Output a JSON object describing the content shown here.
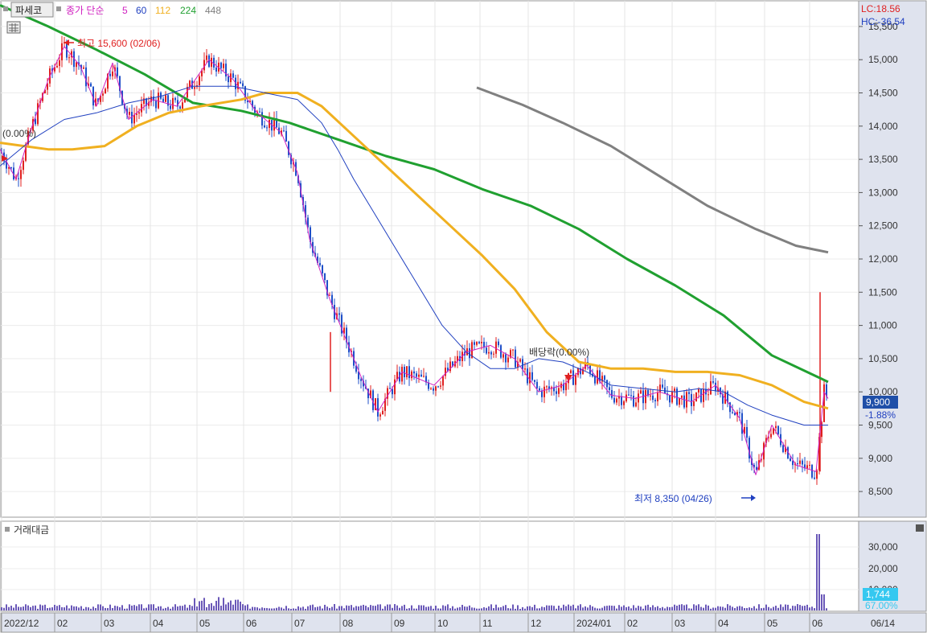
{
  "header": {
    "stock_name": "파세코",
    "indicator": "종가 단순",
    "ma_labels": [
      {
        "text": "5",
        "color": "#d020c0"
      },
      {
        "text": "60",
        "color": "#2040c0"
      },
      {
        "text": "112",
        "color": "#f0b020"
      },
      {
        "text": "224",
        "color": "#20a030"
      },
      {
        "text": "448",
        "color": "#808080"
      }
    ],
    "lc": "LC:18.56",
    "hc": "HC:-36.54"
  },
  "annotations": {
    "high": "최고 15,600 (02/06)",
    "low": "최저 8,350 (04/26)",
    "dividend": "배당락(0.00%)",
    "left_pct": "(0.00%)"
  },
  "current": {
    "price": "9,900",
    "change": "-1.88%",
    "volume": "1,744",
    "volume_pct": "67.00%"
  },
  "volume_panel": {
    "title": "거래대금"
  },
  "chart_data": {
    "type": "line",
    "price_axis": {
      "min": 8150,
      "max": 15850,
      "ticks": [
        "15,500",
        "15,000",
        "14,500",
        "14,000",
        "13,500",
        "13,000",
        "12,500",
        "12,000",
        "11,500",
        "11,000",
        "10,500",
        "10,000",
        "9,500",
        "9,000",
        "8,500"
      ]
    },
    "volume_axis": {
      "ticks": [
        "30,000",
        "20,000",
        "10,000"
      ]
    },
    "x_labels": [
      "2022/12",
      "02",
      "03",
      "04",
      "05",
      "06",
      "07",
      "08",
      "09",
      "10",
      "11",
      "12",
      "2024/01",
      "02",
      "03",
      "04",
      "05",
      "06",
      "06/14"
    ],
    "series": [
      {
        "name": "224",
        "color": "#20a030",
        "points": [
          [
            0,
            15820
          ],
          [
            60,
            15500
          ],
          [
            120,
            15150
          ],
          [
            180,
            14780
          ],
          [
            240,
            14350
          ],
          [
            300,
            14230
          ],
          [
            360,
            14050
          ],
          [
            420,
            13800
          ],
          [
            480,
            13550
          ],
          [
            540,
            13350
          ],
          [
            600,
            13050
          ],
          [
            660,
            12800
          ],
          [
            720,
            12450
          ],
          [
            780,
            12000
          ],
          [
            840,
            11600
          ],
          [
            900,
            11150
          ],
          [
            960,
            10550
          ],
          [
            1030,
            10150
          ]
        ]
      },
      {
        "name": "448",
        "color": "#808080",
        "points": [
          [
            593,
            14580
          ],
          [
            650,
            14320
          ],
          [
            700,
            14050
          ],
          [
            760,
            13700
          ],
          [
            820,
            13250
          ],
          [
            880,
            12800
          ],
          [
            940,
            12450
          ],
          [
            990,
            12200
          ],
          [
            1030,
            12100
          ]
        ]
      },
      {
        "name": "112",
        "color": "#f0b020",
        "points": [
          [
            0,
            13750
          ],
          [
            30,
            13700
          ],
          [
            60,
            13650
          ],
          [
            90,
            13650
          ],
          [
            130,
            13700
          ],
          [
            170,
            14000
          ],
          [
            210,
            14200
          ],
          [
            250,
            14300
          ],
          [
            300,
            14400
          ],
          [
            330,
            14500
          ],
          [
            370,
            14500
          ],
          [
            400,
            14300
          ],
          [
            440,
            13850
          ],
          [
            480,
            13400
          ],
          [
            520,
            12950
          ],
          [
            560,
            12500
          ],
          [
            600,
            12050
          ],
          [
            640,
            11550
          ],
          [
            680,
            10900
          ],
          [
            720,
            10450
          ],
          [
            760,
            10350
          ],
          [
            800,
            10350
          ],
          [
            840,
            10300
          ],
          [
            880,
            10300
          ],
          [
            920,
            10250
          ],
          [
            960,
            10100
          ],
          [
            1000,
            9850
          ],
          [
            1030,
            9750
          ]
        ]
      },
      {
        "name": "60",
        "color": "#2040c0",
        "points": [
          [
            0,
            13400
          ],
          [
            40,
            13800
          ],
          [
            80,
            14100
          ],
          [
            120,
            14200
          ],
          [
            160,
            14350
          ],
          [
            200,
            14450
          ],
          [
            240,
            14600
          ],
          [
            290,
            14600
          ],
          [
            330,
            14500
          ],
          [
            370,
            14400
          ],
          [
            400,
            14050
          ],
          [
            420,
            13650
          ],
          [
            440,
            13200
          ],
          [
            460,
            12800
          ],
          [
            490,
            12200
          ],
          [
            520,
            11600
          ],
          [
            550,
            11000
          ],
          [
            580,
            10600
          ],
          [
            610,
            10350
          ],
          [
            640,
            10350
          ],
          [
            670,
            10500
          ],
          [
            700,
            10450
          ],
          [
            730,
            10300
          ],
          [
            760,
            10100
          ],
          [
            800,
            10050
          ],
          [
            840,
            10000
          ],
          [
            870,
            10050
          ],
          [
            900,
            10000
          ],
          [
            930,
            9800
          ],
          [
            960,
            9650
          ],
          [
            1000,
            9500
          ],
          [
            1030,
            9500
          ]
        ]
      },
      {
        "name": "5",
        "color": "#d020c0",
        "points": [
          [
            0,
            13650
          ],
          [
            20,
            13200
          ],
          [
            40,
            14000
          ],
          [
            60,
            14700
          ],
          [
            80,
            15200
          ],
          [
            100,
            14900
          ],
          [
            120,
            14300
          ],
          [
            140,
            14950
          ],
          [
            160,
            14100
          ],
          [
            190,
            14400
          ],
          [
            220,
            14300
          ],
          [
            260,
            15000
          ],
          [
            290,
            14700
          ],
          [
            320,
            14200
          ],
          [
            350,
            13900
          ],
          [
            370,
            13300
          ],
          [
            385,
            12300
          ],
          [
            410,
            11400
          ],
          [
            430,
            10800
          ],
          [
            450,
            10200
          ],
          [
            470,
            9700
          ],
          [
            500,
            10300
          ],
          [
            540,
            10100
          ],
          [
            580,
            10600
          ],
          [
            610,
            10700
          ],
          [
            640,
            10500
          ],
          [
            670,
            10000
          ],
          [
            700,
            10100
          ],
          [
            730,
            10400
          ],
          [
            760,
            9950
          ],
          [
            790,
            9900
          ],
          [
            820,
            10000
          ],
          [
            860,
            9850
          ],
          [
            890,
            10100
          ],
          [
            920,
            9600
          ],
          [
            940,
            8750
          ],
          [
            960,
            9500
          ],
          [
            990,
            8900
          ],
          [
            1015,
            8800
          ],
          [
            1025,
            10000
          ],
          [
            1030,
            9900
          ]
        ]
      }
    ]
  }
}
